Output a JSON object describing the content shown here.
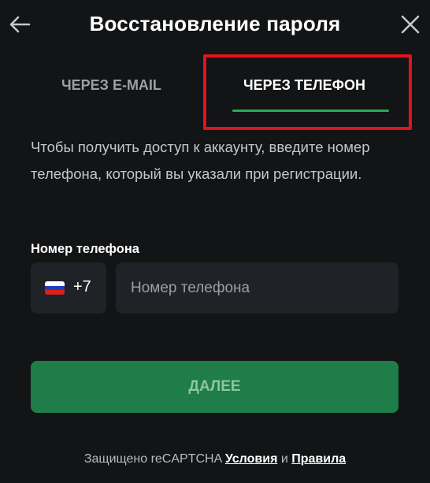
{
  "header": {
    "title": "Восстановление пароля",
    "back_icon": "arrow-left-icon",
    "close_icon": "close-icon"
  },
  "tabs": [
    {
      "label": "ЧЕРЕЗ E-MAIL",
      "active": false
    },
    {
      "label": "ЧЕРЕЗ ТЕЛЕФОН",
      "active": true
    }
  ],
  "description": "Чтобы получить доступ к аккаунту, введите номер телефона, который вы указали при регистрации.",
  "phone": {
    "label": "Номер телефона",
    "country_code": "+7",
    "country_flag": "russia-flag-icon",
    "placeholder": "Номер телефона",
    "value": ""
  },
  "submit_label": "ДАЛЕЕ",
  "footer": {
    "text": "Защищено reCAPTCHA",
    "terms_link": "Условия",
    "and": "и",
    "privacy_link": "Правила"
  },
  "colors": {
    "background": "#121416",
    "input_bg": "#1f2226",
    "accent": "#2da65e",
    "button": "#1e7d48",
    "highlight": "#e8101a"
  }
}
